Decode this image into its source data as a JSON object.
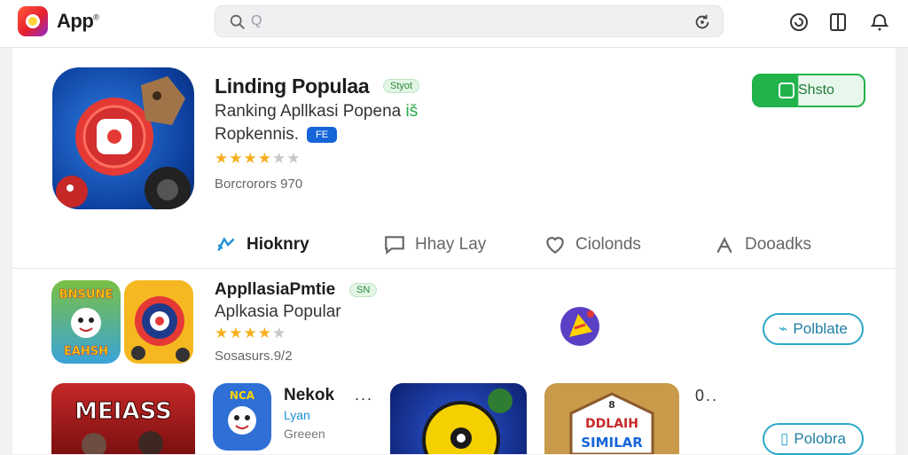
{
  "header": {
    "app_name": "App",
    "app_name_sup": "®",
    "search_placeholder": "Q"
  },
  "featured": {
    "title": "Linding Populaa",
    "badge": "Styot",
    "subtitle": "Ranking  Apllkasi Popena",
    "subtitle_mark": "iš",
    "subtitle2": "Ropkennis.",
    "badge_blue": "FE",
    "rating_filled": 4,
    "rating_total": 5,
    "meta": "Borcrorors 970",
    "get_label": "Shsto"
  },
  "tabs": [
    {
      "label": "Hioknry",
      "icon": "share-icon",
      "active": true
    },
    {
      "label": "Hhay Lay",
      "icon": "chat-icon",
      "active": false
    },
    {
      "label": "Ciolonds",
      "icon": "heart-icon",
      "active": false
    },
    {
      "label": "Dooadks",
      "icon": "bookmark-icon",
      "active": false
    }
  ],
  "row1": {
    "title": "AppllasiaPmtie",
    "badge": "SN",
    "subtitle": "Aplkasia Popular",
    "rating_filled": 4,
    "rating_total": 5,
    "meta": "Sosasurs.9/2",
    "icon1_text_top": "BNSUNE",
    "icon1_text_bottom": "EAHSH",
    "button_label": "Polblate"
  },
  "row2": {
    "card1_text": "MEIASS",
    "mini_title": "Nekok",
    "mini_sub": "Lyan",
    "mini_meta": "Greeen",
    "mini_icon_text": "NCA",
    "card4_text_top": "DDLAIH",
    "card4_text_bottom": "SIMILAR",
    "card4_text_mid": "8",
    "dots_left": "...",
    "dots_right": "0..",
    "button_label": "Polobra"
  },
  "colors": {
    "accent_green": "#22b34b",
    "accent_teal": "#2aa6c9",
    "star": "#f5b01e",
    "badge_blue": "#1565d8"
  }
}
